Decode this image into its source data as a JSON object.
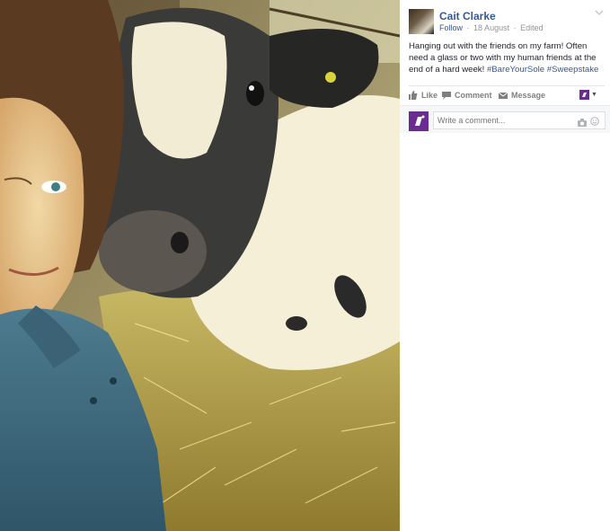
{
  "post": {
    "author": "Cait Clarke",
    "follow": "Follow",
    "date": "18 August",
    "edited": "Edited",
    "text_prefix": "Hanging out with the friends on my farm! Often need a glass or two with my human friends at the end of a hard week! ",
    "tag1": "#BareYourSole",
    "tag2": "#Sweepstake"
  },
  "actions": {
    "like": "Like",
    "comment": "Comment",
    "message": "Message"
  },
  "comment_box": {
    "placeholder": "Write a comment..."
  },
  "icons": {
    "menu": "chevron-down-icon",
    "like": "thumbs-up-icon",
    "comment": "speech-bubble-icon",
    "message": "envelope-icon",
    "camera": "camera-icon",
    "emoji": "smiley-icon"
  },
  "colors": {
    "link": "#365899",
    "brand_purple": "#6a2c91",
    "muted": "#90949c"
  }
}
